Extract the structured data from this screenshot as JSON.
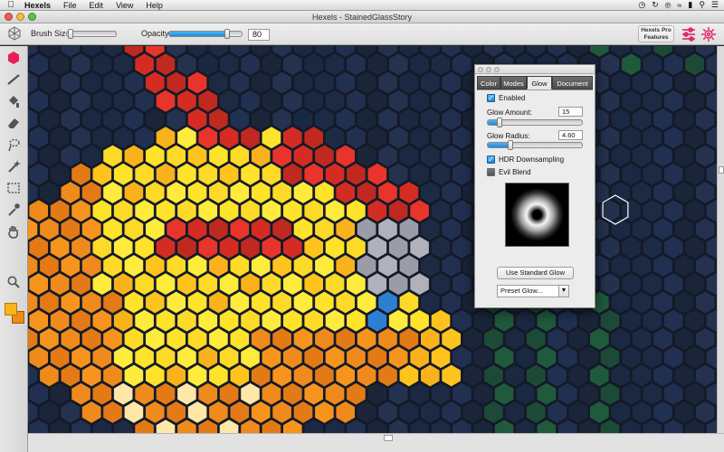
{
  "menubar": {
    "app_name": "Hexels",
    "items": [
      "File",
      "Edit",
      "View",
      "Help"
    ],
    "status_icons": [
      "clock-icon",
      "sync-icon",
      "bluetooth-icon",
      "wifi-icon",
      "battery-icon",
      "search-icon",
      "list-icon"
    ]
  },
  "window": {
    "title": "Hexels - StainedGlassStory"
  },
  "toolbar": {
    "brush_size_label": "Brush Size",
    "brush_size_level": 0.02,
    "opacity_label": "Opacity",
    "opacity_value": "80",
    "opacity_level": 0.8,
    "pro_features_line1": "Hexels Pro",
    "pro_features_line2": "Features"
  },
  "tools": [
    "hex-shape-icon",
    "line-icon",
    "paint-bucket-icon",
    "eraser-icon",
    "lasso-icon",
    "magic-wand-icon",
    "marquee-icon",
    "eyedropper-icon",
    "hand-icon",
    "zoom-icon"
  ],
  "colors": {
    "foreground": "#f7b51c",
    "background_swatch": "#f08a1a",
    "canvas_bg": "#131a28"
  },
  "glow_panel": {
    "tabs": [
      "Color",
      "Modes",
      "Glow",
      "Document"
    ],
    "active_tab": "Glow",
    "enabled_label": "Enabled",
    "enabled": true,
    "glow_amount_label": "Glow Amount:",
    "glow_amount_value": "15",
    "glow_amount_level": 0.1,
    "glow_radius_label": "Glow Radius:",
    "glow_radius_value": "4.60",
    "glow_radius_level": 0.22,
    "hdr_label": "HDR Downsampling",
    "hdr": true,
    "evil_blend_label": "Evil Blend",
    "evil_blend": false,
    "use_standard_glow_label": "Use Standard Glow",
    "preset_glow_label": "Preset Glow..."
  }
}
